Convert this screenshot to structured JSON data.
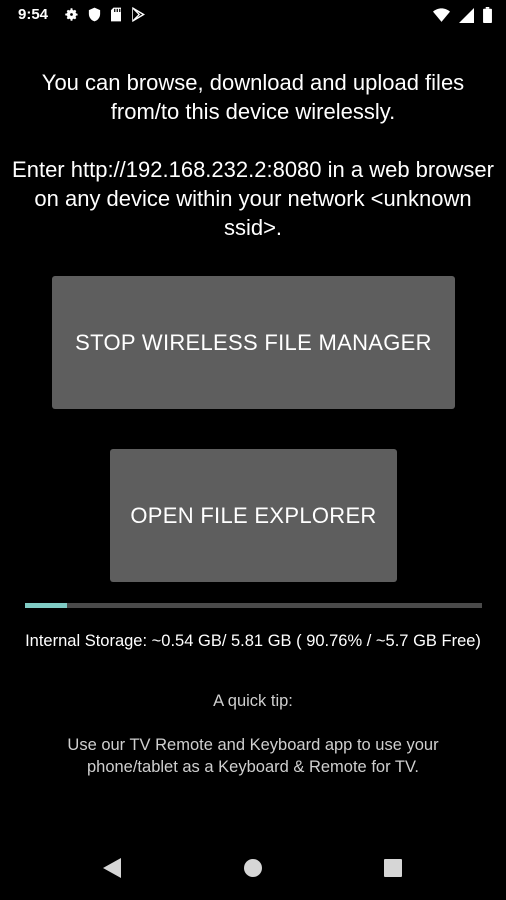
{
  "status_bar": {
    "time": "9:54",
    "left_icons": [
      "settings-icon",
      "shield-icon",
      "sd-card-icon",
      "play-store-icon"
    ],
    "right_icons": [
      "wifi-icon",
      "signal-icon",
      "battery-icon"
    ]
  },
  "intro": {
    "line1": "You can browse, download and upload files from/to this device wirelessly.",
    "line2": "Enter http://192.168.232.2:8080 in a web browser on any device within your network <unknown ssid>."
  },
  "buttons": {
    "stop_label": "STOP WIRELESS FILE MANAGER",
    "open_label": "OPEN FILE EXPLORER"
  },
  "storage": {
    "used_fraction": 0.0924,
    "text": "Internal Storage: ~0.54 GB/ 5.81 GB ( 90.76% / ~5.7 GB Free)"
  },
  "tip": {
    "title": "A quick tip:",
    "text": "Use our TV Remote and Keyboard app to use your phone/tablet as a Keyboard & Remote for TV."
  },
  "nav_bar": {
    "icons": [
      "back-icon",
      "home-icon",
      "recents-icon"
    ]
  },
  "colors": {
    "background": "#000000",
    "button": "#5e5e5e",
    "progress_fill": "#80cbc4",
    "progress_track": "#4a4a4a"
  }
}
